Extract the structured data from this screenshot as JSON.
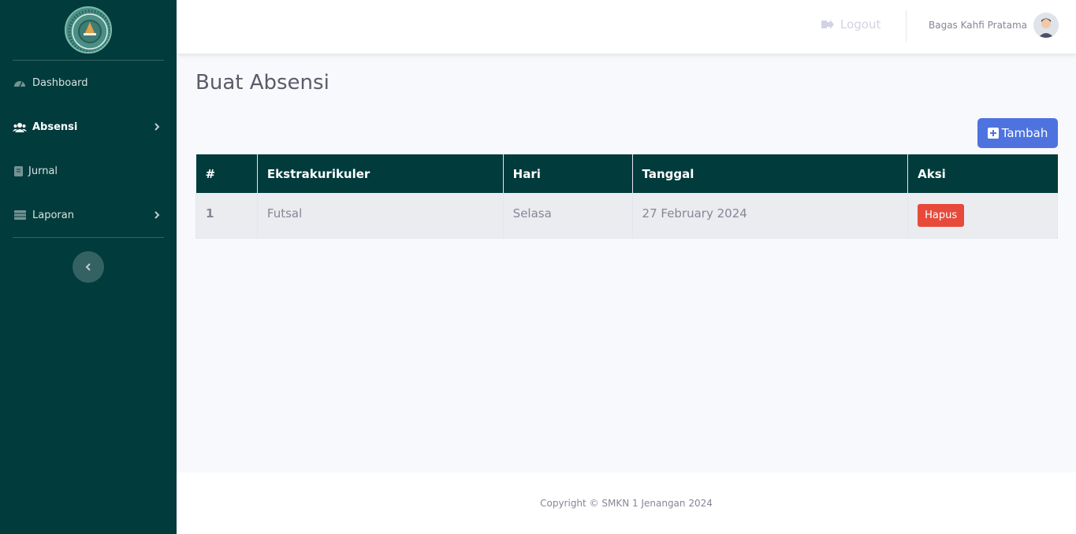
{
  "sidebar": {
    "logo_icon": "school-emblem-icon",
    "items": [
      {
        "label": "Dashboard",
        "icon": "gauge-icon"
      },
      {
        "label": "Absensi",
        "icon": "users-icon",
        "active": true,
        "has_submenu": true
      },
      {
        "label": "Jurnal",
        "icon": "book-icon"
      },
      {
        "label": "Laporan",
        "icon": "table-icon",
        "has_submenu": true
      }
    ],
    "toggle_icon": "chevron-left-icon"
  },
  "topbar": {
    "logout_label": "Logout",
    "user_name": "Bagas Kahfi Pratama"
  },
  "page": {
    "title": "Buat Absensi",
    "add_button_label": "Tambah"
  },
  "table": {
    "headers": [
      "#",
      "Ekstrakurikuler",
      "Hari",
      "Tanggal",
      "Aksi"
    ],
    "rows": [
      {
        "no": "1",
        "ekstrakurikuler": "Futsal",
        "hari": "Selasa",
        "tanggal": "27 February 2024",
        "action_label": "Hapus"
      }
    ]
  },
  "footer": {
    "copyright": "Copyright © SMKN 1 Jenangan 2024"
  },
  "colors": {
    "sidebar_bg": "#023b3b",
    "primary": "#4e73df",
    "danger": "#e74a3b"
  }
}
